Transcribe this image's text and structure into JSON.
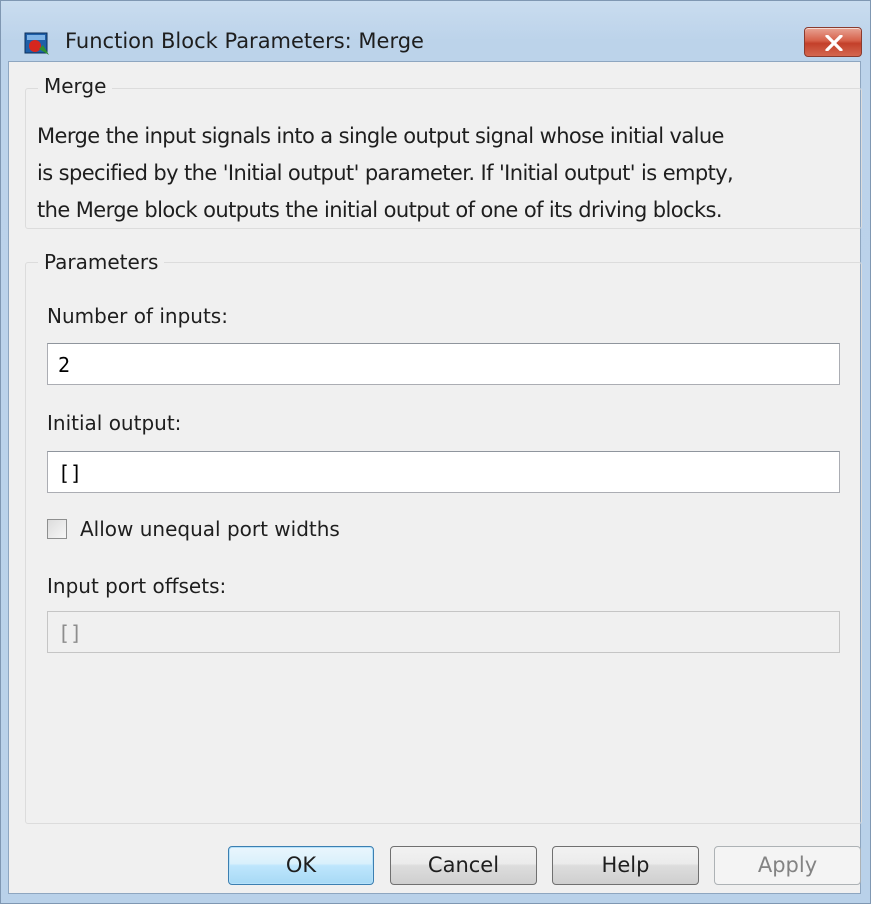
{
  "window": {
    "title": "Function Block Parameters: Merge",
    "icon": "simulink-block-icon",
    "close_icon": "close-icon",
    "close_color": "#c7432c"
  },
  "description_group": {
    "legend": "Merge",
    "lines": [
      "Merge the input signals into a single output signal whose initial value",
      "is specified by the 'Initial output' parameter. If 'Initial output' is empty,",
      "the Merge block outputs the initial output of one of its driving blocks."
    ]
  },
  "parameters_group": {
    "legend": "Parameters",
    "number_of_inputs": {
      "label": "Number of inputs:",
      "value": "2"
    },
    "initial_output": {
      "label": "Initial output:",
      "value": "[]"
    },
    "allow_unequal": {
      "label": "Allow unequal port widths",
      "checked": false
    },
    "input_port_offsets": {
      "label": "Input port offsets:",
      "value": "[]",
      "enabled": false
    }
  },
  "buttons": {
    "ok": "OK",
    "cancel": "Cancel",
    "help": "Help",
    "apply": "Apply"
  },
  "colors": {
    "default_button_border": "#3c7fb1",
    "dialog_background": "#f0f0f0"
  }
}
